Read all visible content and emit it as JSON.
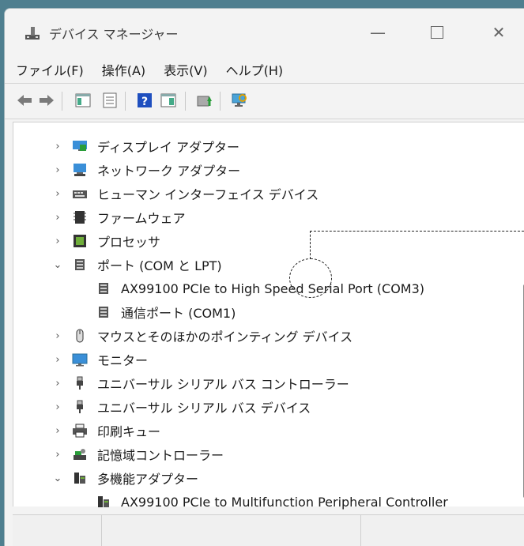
{
  "window": {
    "title": "デバイス マネージャー",
    "controls": {
      "minimize": "—",
      "close": "✕"
    }
  },
  "menu": [
    "ファイル(F)",
    "操作(A)",
    "表示(V)",
    "ヘルプ(H)"
  ],
  "toolbar_icons": [
    "back-arrow-icon",
    "forward-arrow-icon",
    "show-hide-console-tree-icon",
    "properties-icon",
    "help-icon",
    "action-pane-icon",
    "update-driver-icon",
    "scan-hardware-icon"
  ],
  "tree": {
    "categories": [
      {
        "label": "ディスプレイ アダプター",
        "expanded": false,
        "icon": "display-adapter-icon"
      },
      {
        "label": "ネットワーク アダプター",
        "expanded": false,
        "icon": "network-adapter-icon"
      },
      {
        "label": "ヒューマン インターフェイス デバイス",
        "expanded": false,
        "icon": "hid-icon"
      },
      {
        "label": "ファームウェア",
        "expanded": false,
        "icon": "firmware-icon"
      },
      {
        "label": "プロセッサ",
        "expanded": false,
        "icon": "processor-icon"
      },
      {
        "label": "ポート (COM と LPT)",
        "expanded": true,
        "icon": "port-icon",
        "children": [
          "AX99100 PCIe to High Speed Serial Port (COM3)",
          "通信ポート (COM1)"
        ]
      },
      {
        "label": "マウスとそのほかのポインティング デバイス",
        "expanded": false,
        "icon": "mouse-icon"
      },
      {
        "label": "モニター",
        "expanded": false,
        "icon": "monitor-icon"
      },
      {
        "label": "ユニバーサル シリアル バス コントローラー",
        "expanded": false,
        "icon": "usb-icon"
      },
      {
        "label": "ユニバーサル シリアル バス デバイス",
        "expanded": false,
        "icon": "usb-icon"
      },
      {
        "label": "印刷キュー",
        "expanded": false,
        "icon": "printer-icon"
      },
      {
        "label": "記憶域コントローラー",
        "expanded": false,
        "icon": "storage-icon"
      },
      {
        "label": "多機能アダプター",
        "expanded": true,
        "icon": "multifunction-icon",
        "children": [
          "AX99100 PCIe to Multifunction Peripheral Controller"
        ]
      }
    ]
  },
  "colors": {
    "accent": "#0078d4",
    "background": "#4f7f8f"
  }
}
